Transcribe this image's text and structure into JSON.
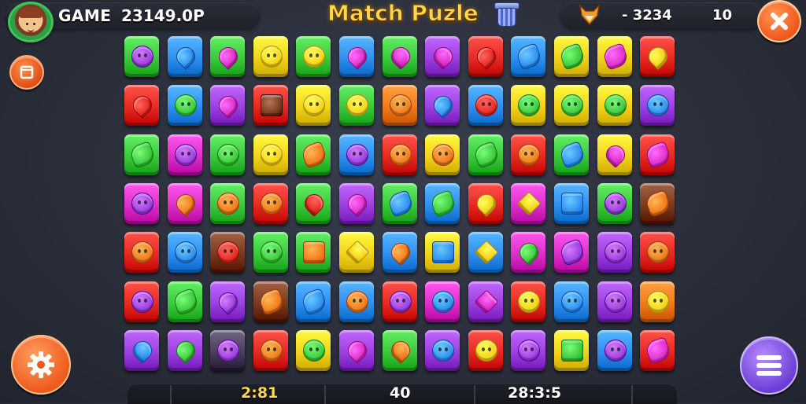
{
  "header": {
    "game_label": "GAME",
    "game_score": "23149.0P",
    "title": "Match Puzle",
    "right_score": "- 3234",
    "right_count": "10"
  },
  "footer": {
    "time": "2:81",
    "moves": "40",
    "right": "28:3:5"
  },
  "colors": {
    "purple": "#9b3fe0",
    "blue": "#2f8ff0",
    "green": "#3cc83c",
    "yellow": "#f3d21a",
    "red": "#e62a22",
    "orange": "#f07a1a",
    "magenta": "#dd2fc8",
    "brown": "#7a3a1e",
    "dark": "#4a3f5a"
  },
  "board": {
    "rows": [
      [
        "green:purple:face",
        "blue:blue:drop",
        "green:magenta:drop",
        "yellow:yellow:face",
        "green:yellow:face",
        "blue:magenta:drop",
        "green:magenta:heart",
        "purple:magenta:heart",
        "red:red:drop",
        "blue:blue:leaf",
        "yellow:green:leaf",
        "yellow:magenta:leaf",
        "red:yellow:drop"
      ],
      [
        "red:red:drop",
        "blue:green:face",
        "purple:magenta:drop",
        "red:brown:square",
        "yellow:yellow:face",
        "green:yellow:face",
        "orange:orange:face",
        "purple:blue:drop",
        "blue:red:face",
        "yellow:green:face",
        "yellow:green:face",
        "yellow:green:face",
        "purple:blue:face"
      ],
      [
        "green:green:leaf",
        "magenta:purple:face",
        "green:green:face",
        "yellow:yellow:face",
        "green:orange:leaf",
        "blue:purple:face",
        "red:orange:face",
        "yellow:orange:face",
        "green:green:leaf",
        "red:orange:face",
        "green:blue:leaf",
        "yellow:magenta:heart",
        "red:magenta:leaf"
      ],
      [
        "magenta:purple:face",
        "magenta:orange:drop",
        "green:orange:face",
        "red:orange:face",
        "green:red:heart",
        "purple:magenta:drop",
        "green:blue:leaf",
        "blue:green:leaf",
        "red:yellow:drop",
        "magenta:yellow:star",
        "blue:blue:square",
        "green:purple:face",
        "brown:orange:leaf"
      ],
      [
        "red:orange:face",
        "blue:blue:face",
        "brown:red:face",
        "green:green:face",
        "green:orange:square",
        "yellow:yellow:star",
        "blue:orange:drop",
        "yellow:blue:square",
        "blue:yellow:star",
        "magenta:green:drop",
        "magenta:purple:leaf",
        "purple:purple:face",
        "red:orange:face"
      ],
      [
        "red:purple:face",
        "green:green:leaf",
        "purple:purple:drop",
        "brown:orange:leaf",
        "blue:blue:leaf",
        "blue:orange:face",
        "red:purple:face",
        "magenta:blue:face",
        "purple:magenta:star",
        "red:yellow:face",
        "blue:blue:face",
        "purple:purple:face",
        "orange:yellow:face"
      ],
      [
        "purple:blue:heart",
        "purple:green:drop",
        "dark:purple:face",
        "red:orange:face",
        "yellow:green:face",
        "purple:magenta:drop",
        "green:orange:heart",
        "purple:blue:face",
        "red:yellow:face",
        "purple:purple:face",
        "yellow:green:square",
        "blue:purple:face",
        "red:magenta:leaf"
      ]
    ]
  }
}
